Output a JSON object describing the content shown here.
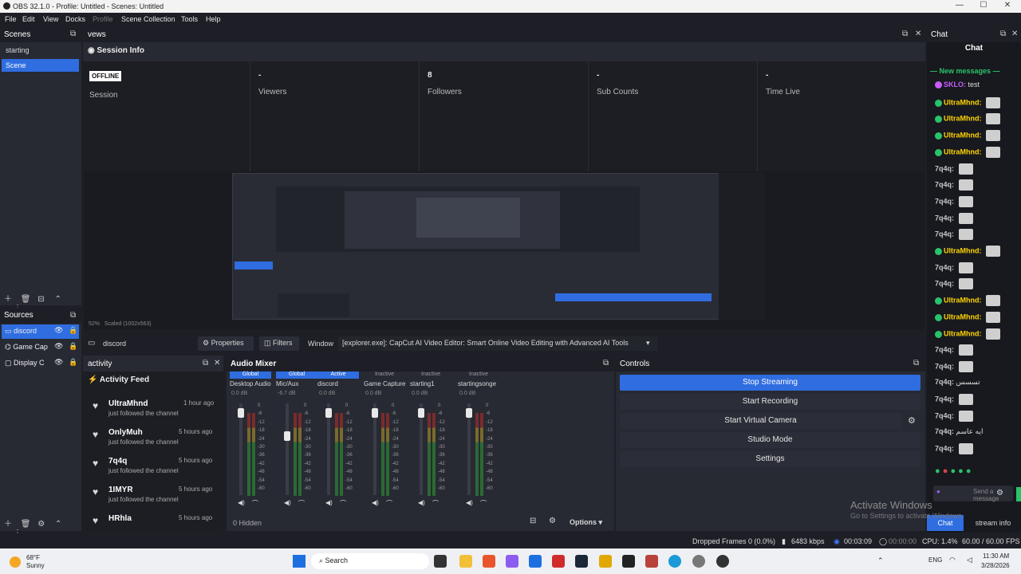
{
  "window": {
    "title": "OBS 32.1.0 - Profile: Untitled - Scenes: Untitled"
  },
  "menu": [
    "File",
    "Edit",
    "View",
    "Docks",
    "Profile",
    "Scene Collection",
    "Tools",
    "Help"
  ],
  "scenes": {
    "title": "Scenes",
    "items": [
      "starting",
      "Scene"
    ],
    "selected": 1
  },
  "views": {
    "title": "vews",
    "session_title": "Session Info",
    "offline": "OFFLINE",
    "stats": [
      {
        "value": "",
        "label": "Session"
      },
      {
        "value": "-",
        "label": "Viewers"
      },
      {
        "value": "8",
        "label": "Followers"
      },
      {
        "value": "-",
        "label": "Sub Counts"
      },
      {
        "value": "-",
        "label": "Time Live"
      }
    ]
  },
  "preview": {
    "zoom": "52%",
    "scaled": "Scaled (1002x563)"
  },
  "sources": {
    "title": "Sources",
    "items": [
      "discord",
      "Game Cap",
      "Display C"
    ]
  },
  "source_toolbar": {
    "name": "discord",
    "properties": "Properties",
    "filters": "Filters",
    "window_label": "Window",
    "window_value": "[explorer.exe]: CapCut AI Video Editor: Smart Online Video Editing with Advanced AI Tools"
  },
  "activity": {
    "dock": "activity",
    "title": "Activity Feed",
    "items": [
      {
        "name": "UltraMhnd",
        "time": "1 hour ago",
        "text": "just followed the channel"
      },
      {
        "name": "OnlyMuh",
        "time": "5 hours ago",
        "text": "just followed the channel"
      },
      {
        "name": "7q4q",
        "time": "5 hours ago",
        "text": "just followed the channel"
      },
      {
        "name": "1IMYR",
        "time": "5 hours ago",
        "text": "just followed the channel"
      },
      {
        "name": "HRhla",
        "time": "5 hours ago",
        "text": ""
      }
    ]
  },
  "mixer": {
    "title": "Audio Mixer",
    "hidden": "0 Hidden",
    "options": "Options",
    "channels": [
      {
        "tag": "Global",
        "name": "Desktop Audio",
        "db": "0.0 dB",
        "level": 0.9,
        "fader": 0.95
      },
      {
        "tag": "Global",
        "name": "Mic/Aux",
        "db": "-6.7 dB",
        "level": 0.9,
        "fader": 0.7
      },
      {
        "tag": "Active",
        "name": "discord",
        "db": "0.0 dB",
        "level": 0.9,
        "fader": 0.95
      },
      {
        "tag": "Inactive",
        "name": "Game Capture",
        "db": "0.0 dB",
        "level": 0.9,
        "fader": 0.95
      },
      {
        "tag": "Inactive",
        "name": "starting1",
        "db": "0.0 dB",
        "level": 0.9,
        "fader": 0.95
      },
      {
        "tag": "Inactive",
        "name": "startingsonge",
        "db": "0.0 dB",
        "level": 0.9,
        "fader": 0.95
      }
    ],
    "scale": [
      "0",
      "-6",
      "-12",
      "-18",
      "-24",
      "-30",
      "-36",
      "-42",
      "-48",
      "-54",
      "-60"
    ]
  },
  "controls": {
    "title": "Controls",
    "buttons": [
      "Stop Streaming",
      "Start Recording",
      "Start Virtual Camera",
      "Studio Mode",
      "Settings"
    ]
  },
  "chat": {
    "dock": "Chat",
    "title": "Chat",
    "new_messages": "New messages",
    "messages": [
      {
        "user": "SKLO:",
        "text": "test",
        "color": "#c65cff"
      },
      {
        "user": "UltraMhnd:",
        "text": "",
        "color": "#ffd500"
      },
      {
        "user": "UltraMhnd:",
        "text": "",
        "color": "#ffd500"
      },
      {
        "user": "UltraMhnd:",
        "text": "",
        "color": "#ffd500"
      },
      {
        "user": "UltraMhnd:",
        "text": "",
        "color": "#ffd500"
      },
      {
        "user": "7q4q:",
        "text": "",
        "color": "#c9c9c9"
      },
      {
        "user": "7q4q:",
        "text": "",
        "color": "#c9c9c9"
      },
      {
        "user": "7q4q:",
        "text": "",
        "color": "#c9c9c9"
      },
      {
        "user": "7q4q:",
        "text": "",
        "color": "#c9c9c9"
      },
      {
        "user": "7q4q:",
        "text": "",
        "color": "#c9c9c9"
      },
      {
        "user": "UltraMhnd:",
        "text": "",
        "color": "#ffd500"
      },
      {
        "user": "7q4q:",
        "text": "",
        "color": "#c9c9c9"
      },
      {
        "user": "7q4q:",
        "text": "",
        "color": "#c9c9c9"
      },
      {
        "user": "UltraMhnd:",
        "text": "",
        "color": "#ffd500"
      },
      {
        "user": "UltraMhnd:",
        "text": "",
        "color": "#ffd500"
      },
      {
        "user": "UltraMhnd:",
        "text": "",
        "color": "#ffd500"
      },
      {
        "user": "7q4q:",
        "text": "",
        "color": "#c9c9c9"
      },
      {
        "user": "7q4q:",
        "text": "",
        "color": "#c9c9c9"
      },
      {
        "user": "7q4q:",
        "text": "تسسس",
        "color": "#c9c9c9"
      },
      {
        "user": "7q4q:",
        "text": "",
        "color": "#c9c9c9"
      },
      {
        "user": "7q4q:",
        "text": "",
        "color": "#c9c9c9"
      },
      {
        "user": "7q4q:",
        "text": "ايه عاسم",
        "color": "#c9c9c9"
      },
      {
        "user": "7q4q:",
        "text": "",
        "color": "#c9c9c9"
      }
    ],
    "send_placeholder": "Send a message",
    "tab_chat": "Chat",
    "tab_info": "stream info"
  },
  "watermark": {
    "line1": "Activate Windows",
    "line2": "Go to Settings to activate Windows."
  },
  "status": {
    "dropped": "Dropped Frames 0 (0.0%)",
    "kbps": "6483 kbps",
    "time1": "00:03:09",
    "time2": "00:00:00",
    "cpu": "CPU: 1.4%",
    "fps": "60.00 / 60.00 FPS"
  },
  "taskbar": {
    "temp": "68°F",
    "weather": "Sunny",
    "search": "Search",
    "lang": "ENG",
    "time": "11:30 AM",
    "date": "3/28/2026"
  }
}
